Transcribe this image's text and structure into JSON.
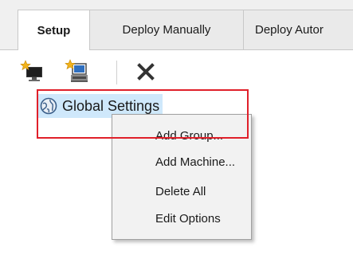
{
  "tabs": [
    {
      "label": "Setup",
      "active": true
    },
    {
      "label": "Deploy Manually",
      "active": false
    },
    {
      "label": "Deploy Autor",
      "active": false
    }
  ],
  "toolbar": {
    "icons": [
      "add-group-icon",
      "add-machine-icon",
      "delete-icon"
    ]
  },
  "tree": {
    "root_label": "Global Settings"
  },
  "context_menu": {
    "items": [
      {
        "label": "Add Group..."
      },
      {
        "label": "Add Machine..."
      },
      {
        "label": "Delete All"
      },
      {
        "label": "Edit Options"
      }
    ]
  },
  "colors": {
    "highlight_border": "#e0202a",
    "selection": "#cfe8fb",
    "delete_icon": "#333333"
  }
}
